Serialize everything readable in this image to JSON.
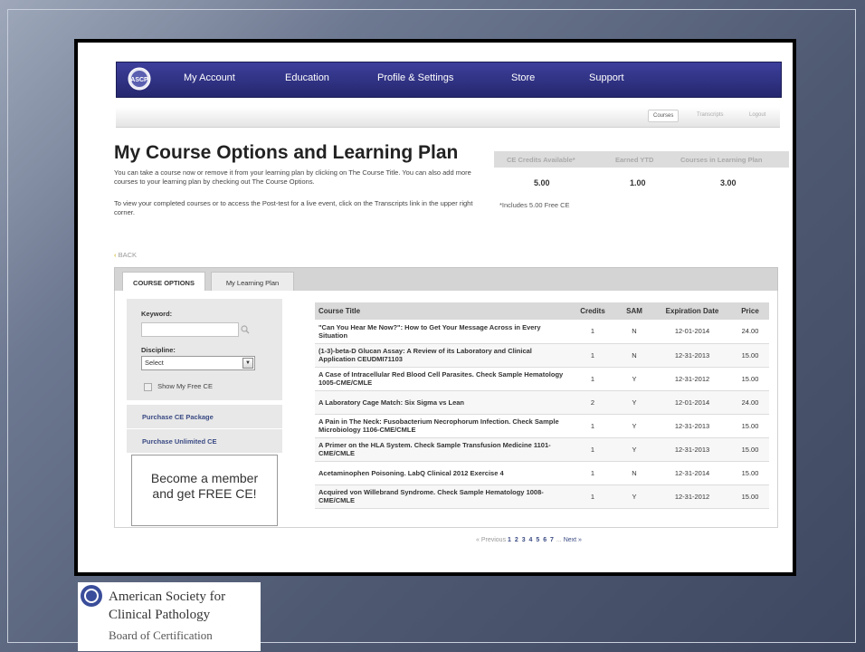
{
  "nav": {
    "items": [
      "My Account",
      "Education",
      "Profile & Settings",
      "Store",
      "Support"
    ]
  },
  "subnav": {
    "courses": "Courses",
    "transcripts": "Transcripts",
    "logout": "Logout"
  },
  "page": {
    "title": "My Course Options and Learning Plan",
    "intro1": "You can take a course now or remove it from your learning plan by clicking on The Course Title. You can also add more courses to your learning plan by checking out The Course Options.",
    "intro2": "To view your completed courses or to access the Post-test for a live event, click on the Transcripts link in the upper right corner.",
    "back": "BACK"
  },
  "credits": {
    "headers": [
      "CE Credits Available*",
      "Earned YTD",
      "Courses in Learning Plan"
    ],
    "values": [
      "5.00",
      "1.00",
      "3.00"
    ],
    "note": "*Includes 5.00 Free CE"
  },
  "tabs": [
    "COURSE OPTIONS",
    "My Learning Plan"
  ],
  "sidebar": {
    "keyword_label": "Keyword:",
    "keyword_value": "",
    "discipline_label": "Discipline:",
    "discipline_value": "Select",
    "free_ce_label": "Show My Free CE",
    "purchase_package": "Purchase CE Package",
    "purchase_unlimited": "Purchase Unlimited CE",
    "promo_line1": "Become a member",
    "promo_line2": "and get FREE CE!"
  },
  "table": {
    "headers": [
      "Course Title",
      "Credits",
      "SAM",
      "Expiration Date",
      "Price"
    ],
    "rows": [
      {
        "title": "\"Can You Hear Me Now?\": How to Get Your Message Across in Every Situation",
        "credits": "1",
        "sam": "N",
        "exp": "12-01-2014",
        "price": "24.00"
      },
      {
        "title": "(1-3)-beta-D Glucan Assay: A Review of its Laboratory and Clinical Application CEUDMI71103",
        "credits": "1",
        "sam": "N",
        "exp": "12-31-2013",
        "price": "15.00"
      },
      {
        "title": "A Case of Intracellular Red Blood Cell Parasites. Check Sample Hematology 1005-CME/CMLE",
        "credits": "1",
        "sam": "Y",
        "exp": "12-31-2012",
        "price": "15.00"
      },
      {
        "title": "A Laboratory Cage Match: Six Sigma vs Lean",
        "credits": "2",
        "sam": "Y",
        "exp": "12-01-2014",
        "price": "24.00"
      },
      {
        "title": "A Pain in The Neck: Fusobacterium Necrophorum Infection. Check Sample Microbiology 1106-CME/CMLE",
        "credits": "1",
        "sam": "Y",
        "exp": "12-31-2013",
        "price": "15.00"
      },
      {
        "title": "A Primer on the HLA System. Check Sample Transfusion Medicine 1101-CME/CMLE",
        "credits": "1",
        "sam": "Y",
        "exp": "12-31-2013",
        "price": "15.00"
      },
      {
        "title": "Acetaminophen Poisoning. LabQ Clinical 2012 Exercise 4",
        "credits": "1",
        "sam": "N",
        "exp": "12-31-2014",
        "price": "15.00"
      },
      {
        "title": "Acquired von Willebrand Syndrome. Check Sample Hematology 1008-CME/CMLE",
        "credits": "1",
        "sam": "Y",
        "exp": "12-31-2012",
        "price": "15.00"
      }
    ]
  },
  "pager": {
    "previous": "« Previous",
    "pages": "1 2 3 4 5 6 7",
    "ellipsis": "...",
    "next": "Next »"
  },
  "org": {
    "line1": "American Society for",
    "line2": "Clinical Pathology",
    "line3": "Board of Certification"
  }
}
